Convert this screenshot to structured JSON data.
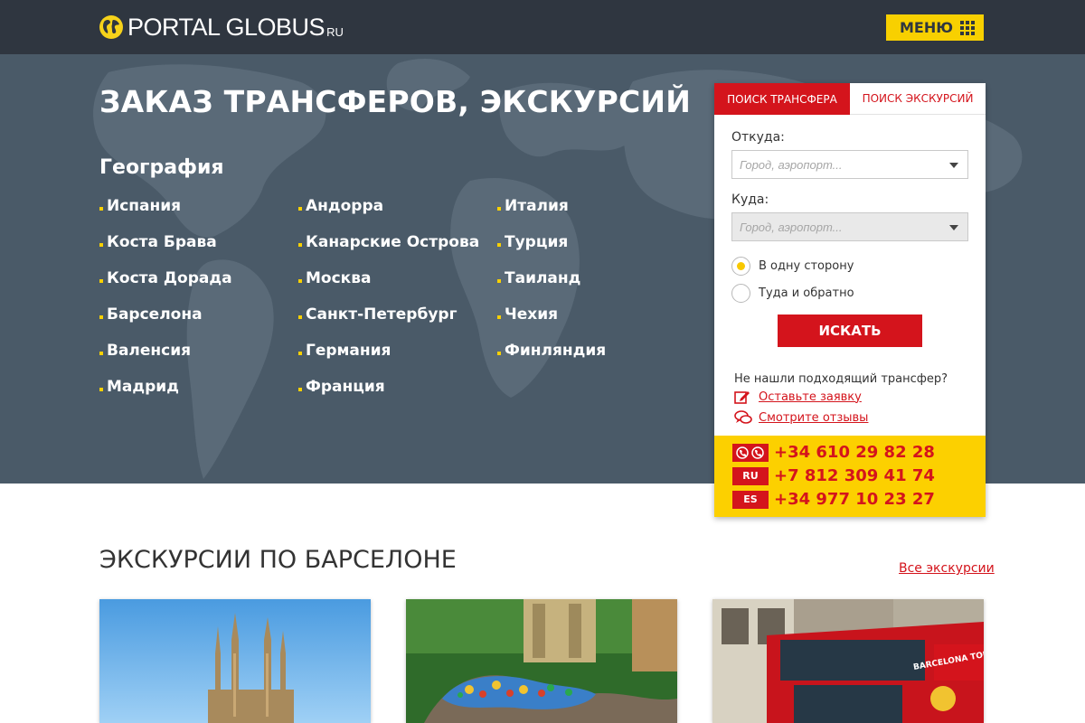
{
  "header": {
    "logo_text": "PORTAL GLOBUS",
    "logo_suffix": "RU",
    "menu_label": "МЕНЮ"
  },
  "hero": {
    "title": "ЗАКАЗ ТРАНСФЕРОВ, ЭКСКУРСИЙ",
    "geo_title": "География",
    "columns": [
      [
        "Испания",
        "Коста Брава",
        "Коста Дорада",
        "Барселона",
        "Валенсия",
        "Мадрид"
      ],
      [
        "Андорра",
        "Канарские Острова",
        "Москва",
        "Санкт-Петербург",
        "Германия",
        "Франция"
      ],
      [
        "Италия",
        "Турция",
        "Таиланд",
        "Чехия",
        "Финляндия"
      ]
    ]
  },
  "search": {
    "tabs": [
      "ПОИСК ТРАНСФЕРА",
      "ПОИСК ЭКСКУРСИЙ"
    ],
    "from_label": "Откуда:",
    "from_placeholder": "Город, аэропорт...",
    "to_label": "Куда:",
    "to_placeholder": "Город, аэропорт...",
    "radio_one_way": "В одну сторону",
    "radio_round_trip": "Туда и обратно",
    "search_button": "ИСКАТЬ",
    "not_found": "Не нашли подходящий трансфер?",
    "leave_request": "Оставьте заявку",
    "see_reviews": "Смотрите отзывы",
    "phones": [
      {
        "badge": "",
        "number": "+34 610 29 82 28"
      },
      {
        "badge": "RU",
        "number": "+7 812 309 41 74"
      },
      {
        "badge": "ES",
        "number": "+34 977 10 23 27"
      }
    ]
  },
  "excursions": {
    "title": "ЭКСКУРСИИ ПО БАРСЕЛОНЕ",
    "all_link": "Все экскурсии",
    "cards": [
      {
        "image": "sagrada-familia-photo"
      },
      {
        "image": "park-guell-dragon-photo"
      },
      {
        "image": "barcelona-tour-bus-photo",
        "bus_text": "BARCELONA TOUR"
      }
    ]
  },
  "colors": {
    "header_bg": "#2f3640",
    "hero_bg": "#4a5a68",
    "accent_yellow": "#f8d000",
    "accent_red": "#d4141c"
  }
}
